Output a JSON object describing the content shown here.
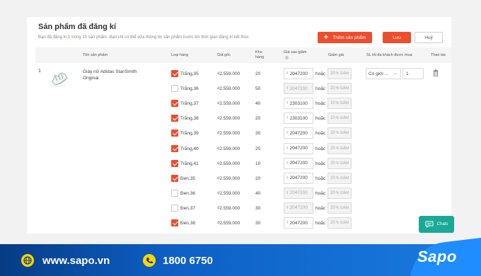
{
  "page": {
    "title": "Sản phẩm đã đăng kí",
    "subtitle_pre": "Bạn đã đăng kí",
    "subtitle_count": "1",
    "subtitle_post": "trong 10 sản phẩm.  Bạn chỉ có thể sửa thông tin sản phẩm trước khi thời gian đăng kí kết thúc",
    "add_button": "Thêm sản phẩm",
    "save_button": "Lưu",
    "cancel_button": "Huỷ"
  },
  "table": {
    "headers": {
      "name": "Tên sản phẩm",
      "type": "Loại hàng",
      "orig_price": "Giá gốc",
      "stock_line1": "Kho",
      "stock_line2": "hàng",
      "sale_price": "Giá sau giảm",
      "discount": "Giảm giá",
      "max_qty": "SL tối đa khách được mua",
      "actions": "Thao tác"
    },
    "product": {
      "index": "1",
      "name": "Giày nữ Adidas StanSmith Original",
      "limit_select": "Có giới ...",
      "limit_qty": "1"
    },
    "currency": "₫",
    "or_label": "hoặc",
    "pct_unit": "% GIẢM",
    "rows": [
      {
        "checked": true,
        "type": "Trắng,35",
        "orig": "₫2.559.000",
        "stock": "20",
        "price": "2047200",
        "pct": "20"
      },
      {
        "checked": false,
        "type": "Trắng,36",
        "orig": "₫2.559.000",
        "stock": "50",
        "price": "2047200",
        "pct": "20"
      },
      {
        "checked": true,
        "type": "Trắng,37",
        "orig": "₫2.559.000",
        "stock": "40",
        "price": "2303100",
        "pct": "10"
      },
      {
        "checked": true,
        "type": "Trắng,38",
        "orig": "₫2.559.000",
        "stock": "20",
        "price": "2303100",
        "pct": "10"
      },
      {
        "checked": true,
        "type": "Trắng,39",
        "orig": "₫2.559.000",
        "stock": "30",
        "price": "2047200",
        "pct": "20"
      },
      {
        "checked": true,
        "type": "Trắng,40",
        "orig": "₫2.559.000",
        "stock": "20",
        "price": "2047200",
        "pct": "20"
      },
      {
        "checked": true,
        "type": "Trắng,41",
        "orig": "₫2.559.000",
        "stock": "10",
        "price": "2047200",
        "pct": "20"
      },
      {
        "checked": true,
        "type": "Đen,35",
        "orig": "₫2.559.000",
        "stock": "20",
        "price": "2047200",
        "pct": "20"
      },
      {
        "checked": false,
        "type": "Đen,36",
        "orig": "₫2.559.000",
        "stock": "40",
        "price": "2047200",
        "pct": "20"
      },
      {
        "checked": false,
        "type": "Đen,37",
        "orig": "₫2.559.000",
        "stock": "30",
        "price": "2047200",
        "pct": "20"
      },
      {
        "checked": true,
        "type": "Đen,38",
        "orig": "₫2.559.000",
        "stock": "30",
        "price": "2047200",
        "pct": "20"
      }
    ]
  },
  "chat": {
    "label": "Chats"
  },
  "footer": {
    "website": "www.sapo.vn",
    "phone": "1800 6750",
    "logo": "Sapo"
  },
  "colors": {
    "accent": "#ee4d2d",
    "chat": "#1aa996",
    "footer": "#0d5fc4",
    "icon_yellow": "#ffd400"
  },
  "icons": [
    "plus-icon",
    "chevron-down-icon",
    "trash-icon",
    "chat-icon",
    "globe-icon",
    "phone-icon"
  ]
}
